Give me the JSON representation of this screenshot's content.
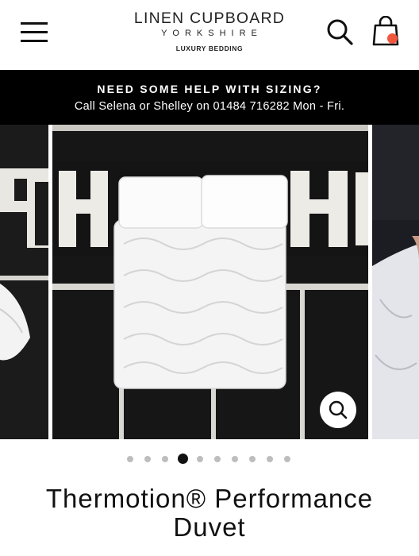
{
  "header": {
    "logo": {
      "name": "LINEN CUPBOARD",
      "location": "YORKSHIRE",
      "tagline": "LUXURY BEDDING"
    },
    "icons": {
      "menu": "hamburger-menu-icon",
      "search": "search-icon",
      "cart": "shopping-bag-icon"
    },
    "cart_badge_color": "#f0573e"
  },
  "banner": {
    "title": "NEED SOME HELP WITH SIZING?",
    "subtitle": "Call Selena or Shelley on 01484 716282 Mon - Fri."
  },
  "gallery": {
    "slide_count": 10,
    "active_index": 3,
    "zoom_icon": "zoom-icon"
  },
  "product": {
    "title": "Thermotion® Performance Duvet"
  }
}
